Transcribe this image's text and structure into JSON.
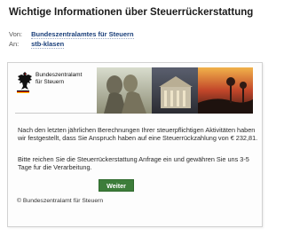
{
  "email": {
    "subject": "Wichtige Informationen über Steuerrückerstattung",
    "from_label": "Von:",
    "from_value": "Bundeszentralamtes für Steuern",
    "to_label": "An:",
    "to_value": "stb-klasen"
  },
  "banner": {
    "brand_line1": "Bundeszentralamt",
    "brand_line2": "für Steuern",
    "flag_colors": [
      "#000000",
      "#dd0000",
      "#ffcc00"
    ]
  },
  "body": {
    "paragraph1": "Nach den letzten jährlichen Berechnungen Ihrer steuerpflichtigen Aktivitäten haben wir festgestellt, dass Sie Anspruch haben auf eine Steuerrückzahlung von € 232,81.",
    "paragraph2": "Bitte reichen Sie die Steuerrückerstattung Anfrage ein und gewähren Sie uns 3-5 Tage fur die Verarbeitung.",
    "button_label": "Weiter",
    "footer": "© Bundeszentralamt für Steuern"
  },
  "colors": {
    "button_bg": "#3d7d3a",
    "sender_link": "#1a3f7a"
  }
}
